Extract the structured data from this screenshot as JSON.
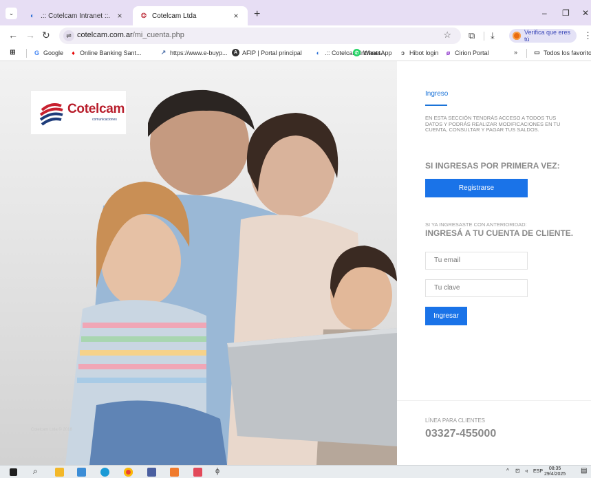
{
  "browser": {
    "tabs": [
      {
        "title": ".:: Cotelcam Intranet ::.",
        "active": false
      },
      {
        "title": "Cotelcam Ltda",
        "active": true
      }
    ],
    "new_tab": "+",
    "close_glyph": "×",
    "address": {
      "host": "cotelcam.com.ar",
      "path": "/mi_cuenta.php"
    },
    "profile_pill": "Verifica que eres tú",
    "bookmarks": [
      {
        "label": "Google",
        "icon": "google-icon"
      },
      {
        "label": "Online Banking Sant...",
        "icon": "santander-icon"
      },
      {
        "label": "https://www.e-buyp...",
        "icon": "link-icon"
      },
      {
        "label": "AFIP | Portal principal",
        "icon": "afip-icon"
      },
      {
        "label": ".:: Cotelcam Intranet...",
        "icon": "cotelcam-icon"
      },
      {
        "label": "WhatsApp",
        "icon": "whatsapp-icon"
      },
      {
        "label": "Hibot login",
        "icon": "hibot-icon"
      },
      {
        "label": "Cirion Portal",
        "icon": "cirion-icon"
      }
    ],
    "bookmarks_more": "»",
    "all_bookmarks": "Todos los favoritos"
  },
  "brand": {
    "name": "Cotelcam",
    "tagline": "comunicaciones",
    "copyright": "Cotelcam Ltda © 2018"
  },
  "login": {
    "section_tab": "Ingreso",
    "description": "EN ESTA SECCIÓN TENDRÁS ACCESO A TODOS TUS DATOS Y PODRÁS REALIZAR MODIFICACIONES EN TU CUENTA, CONSULTAR Y PAGAR TUS SALDOS.",
    "first_time_heading": "SI INGRESAS POR PRIMERA VEZ:",
    "register_button": "Registrarse",
    "returning_small": "SI YA INGRESASTE CON ANTERIORIDAD:",
    "returning_heading": "INGRESÁ A TU CUENTA DE CLIENTE.",
    "email_placeholder": "Tu email",
    "password_placeholder": "Tu clave",
    "login_button": "Ingresar",
    "hotline_label": "LÍNEA PARA CLIENTES",
    "hotline_number": "03327-455000"
  },
  "taskbar": {
    "language": "ESP",
    "time": "08:35",
    "date": "29/4/2025"
  },
  "colors": {
    "accent": "#1a73e8",
    "brand_red": "#b81d2b",
    "tab_strip": "#e7def4"
  }
}
